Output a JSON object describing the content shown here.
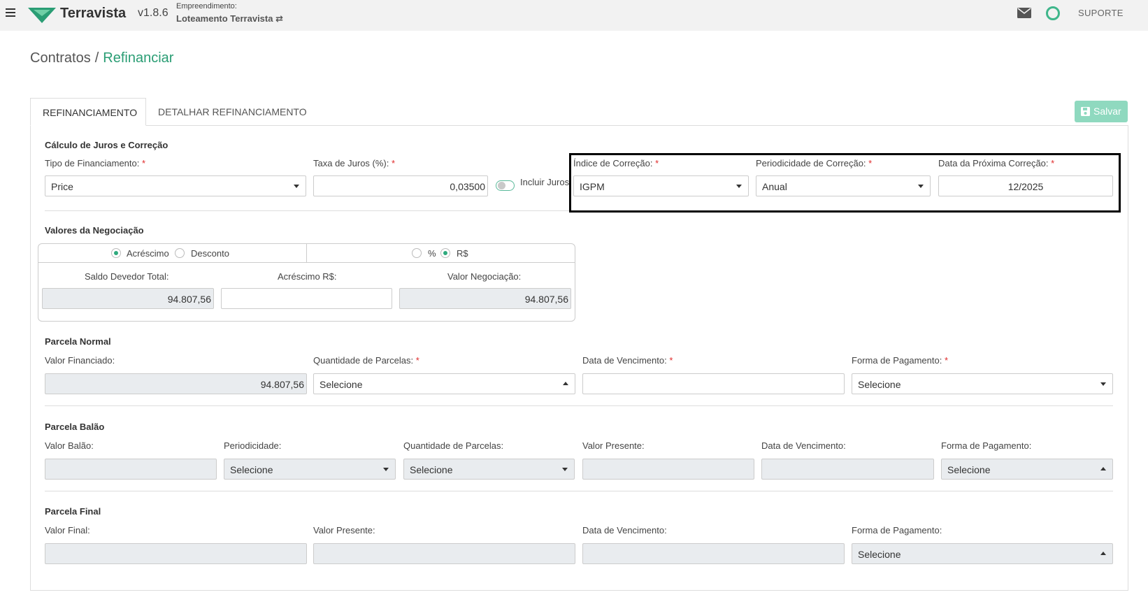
{
  "topbar": {
    "brand": "Terravista",
    "version": "v1.8.6",
    "empreendimento_label": "Empreendimento:",
    "empreendimento_value": "Loteamento Terravista ⇄",
    "support_label": "SUPORTE"
  },
  "breadcrumb": {
    "parent": "Contratos",
    "separator": "/",
    "current": "Refinanciar"
  },
  "tabs": [
    {
      "label": "REFINANCIAMENTO",
      "active": true
    },
    {
      "label": "DETALHAR REFINANCIAMENTO",
      "active": false
    }
  ],
  "save_label": "Salvar",
  "calculo": {
    "title": "Cálculo de Juros e Correção",
    "tipo_label": "Tipo de Financiamento:",
    "tipo_value": "Price",
    "taxa_label": "Taxa de Juros (%):",
    "taxa_value": "0,03500",
    "incluir_juros_label": "Incluir Juros",
    "indice_label": "Índice de Correção:",
    "indice_value": "IGPM",
    "periodicidade_label": "Periodicidade de Correção:",
    "periodicidade_value": "Anual",
    "data_label": "Data da Próxima Correção:",
    "data_value": "12/2025"
  },
  "negociacao": {
    "title": "Valores da Negociação",
    "acrescimo_label": "Acréscimo",
    "desconto_label": "Desconto",
    "percent_label": "%",
    "rs_label": "R$",
    "saldo_label": "Saldo Devedor Total:",
    "saldo_value": "94.807,56",
    "acrescimo_rs_label": "Acréscimo R$:",
    "acrescimo_rs_value": "",
    "valor_neg_label": "Valor Negociação:",
    "valor_neg_value": "94.807,56"
  },
  "normal": {
    "title": "Parcela Normal",
    "valor_label": "Valor Financiado:",
    "valor_value": "94.807,56",
    "qtd_label": "Quantidade de Parcelas:",
    "qtd_value": "Selecione",
    "venc_label": "Data de Vencimento:",
    "forma_label": "Forma de Pagamento:",
    "forma_value": "Selecione"
  },
  "balao": {
    "title": "Parcela Balão",
    "valor_label": "Valor Balão:",
    "periodicidade_label": "Periodicidade:",
    "periodicidade_value": "Selecione",
    "qtd_label": "Quantidade de Parcelas:",
    "qtd_value": "Selecione",
    "presente_label": "Valor Presente:",
    "venc_label": "Data de Vencimento:",
    "forma_label": "Forma de Pagamento:",
    "forma_value": "Selecione"
  },
  "final": {
    "title": "Parcela Final",
    "valor_label": "Valor Final:",
    "presente_label": "Valor Presente:",
    "venc_label": "Data de Vencimento:",
    "forma_label": "Forma de Pagamento:",
    "forma_value": "Selecione"
  },
  "colors": {
    "accent": "#2a9d74",
    "required": "#e02b2b",
    "save_button": "#8fd9bf"
  }
}
